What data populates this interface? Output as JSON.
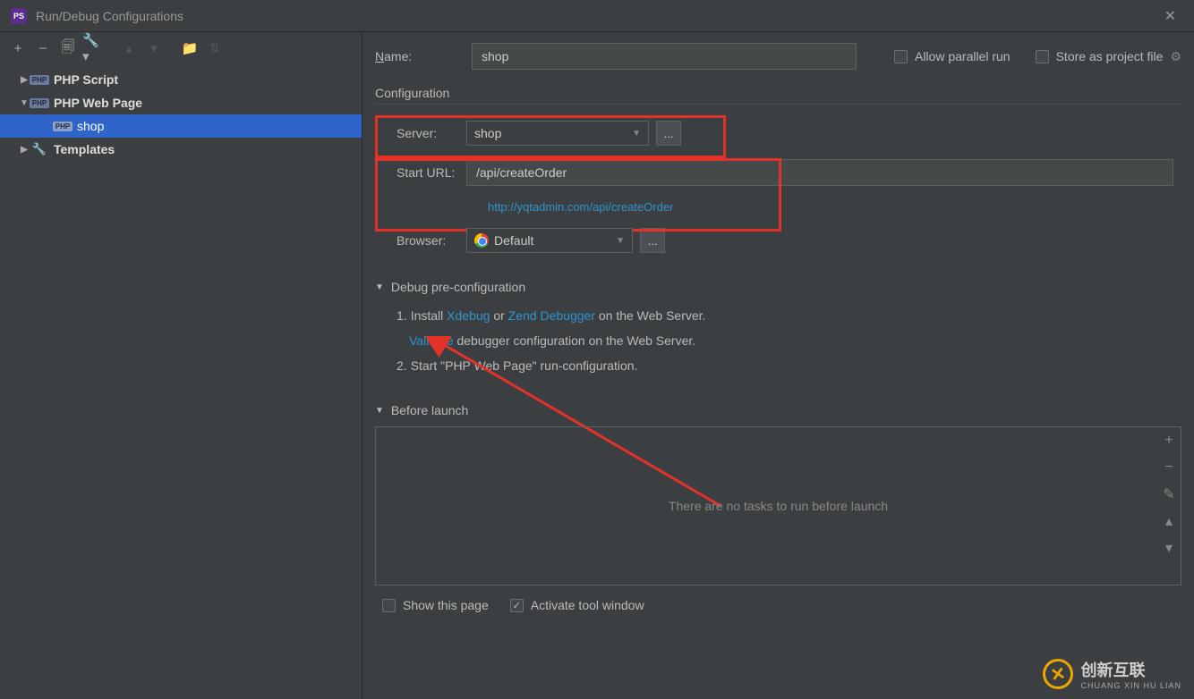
{
  "window": {
    "title": "Run/Debug Configurations"
  },
  "toolbar": {
    "add": "+",
    "remove": "−"
  },
  "tree": {
    "items": [
      {
        "label": "PHP Script",
        "expanded": false
      },
      {
        "label": "PHP Web Page",
        "expanded": true
      },
      {
        "label": "shop",
        "selected": true
      },
      {
        "label": "Templates",
        "expanded": false
      }
    ]
  },
  "form": {
    "name_label": "Name:",
    "name_value": "shop",
    "allow_parallel": "Allow parallel run",
    "store_project": "Store as project file",
    "configuration_title": "Configuration",
    "server_label": "Server:",
    "server_value": "shop",
    "start_url_label": "Start URL:",
    "start_url_value": "/api/createOrder",
    "full_url": "http://yqtadmin.com/api/createOrder",
    "browser_label": "Browser:",
    "browser_value": "Default",
    "browse_btn": "..."
  },
  "debug": {
    "title": "Debug pre-configuration",
    "step1_prefix": "Install ",
    "xdebug": "Xdebug",
    "or": " or ",
    "zend": "Zend Debugger",
    "step1_suffix": " on the Web Server.",
    "validate": "Validate",
    "validate_suffix": " debugger configuration on the Web Server.",
    "step2": "Start \"PHP Web Page\" run-configuration."
  },
  "before_launch": {
    "title": "Before launch",
    "empty": "There are no tasks to run before launch"
  },
  "bottom": {
    "show_page": "Show this page",
    "activate": "Activate tool window"
  },
  "watermark": {
    "brand": "创新互联",
    "sub": "CHUANG XIN HU LIAN"
  }
}
